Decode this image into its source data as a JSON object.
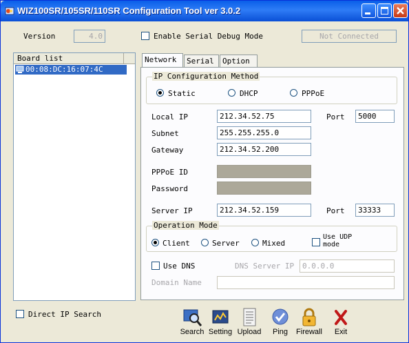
{
  "window": {
    "title": "WIZ100SR/105SR/110SR Configuration Tool ver 3.0.2"
  },
  "top": {
    "version_label": "Version",
    "version_value": "4.0",
    "serial_debug_label": "Enable Serial Debug Mode",
    "connection_status": "Not Connected"
  },
  "board_list": {
    "header": "Board list",
    "items": [
      "00:08:DC:16:07:4C"
    ]
  },
  "tabs": [
    "Network",
    "Serial",
    "Option"
  ],
  "ip_method": {
    "title": "IP Configuration Method",
    "options": [
      "Static",
      "DHCP",
      "PPPoE"
    ],
    "selected": "Static"
  },
  "network": {
    "local_ip_label": "Local IP",
    "local_ip": "212.34.52.75",
    "port_label": "Port",
    "port": "5000",
    "subnet_label": "Subnet",
    "subnet": "255.255.255.0",
    "gateway_label": "Gateway",
    "gateway": "212.34.52.200",
    "pppoe_id_label": "PPPoE ID",
    "password_label": "Password",
    "server_ip_label": "Server IP",
    "server_ip": "212.34.52.159",
    "server_port_label": "Port",
    "server_port": "33333"
  },
  "operation_mode": {
    "title": "Operation Mode",
    "options": [
      "Client",
      "Server",
      "Mixed"
    ],
    "selected": "Client",
    "udp_label_1": "Use UDP",
    "udp_label_2": "mode"
  },
  "dns": {
    "use_dns_label": "Use DNS",
    "server_ip_label": "DNS Server IP",
    "server_ip": "0.0.0.0",
    "domain_label": "Domain Name",
    "domain": ""
  },
  "bottom": {
    "direct_ip_label": "Direct IP Search"
  },
  "toolbar": [
    "Search",
    "Setting",
    "Upload",
    "Ping",
    "Firewall",
    "Exit"
  ]
}
